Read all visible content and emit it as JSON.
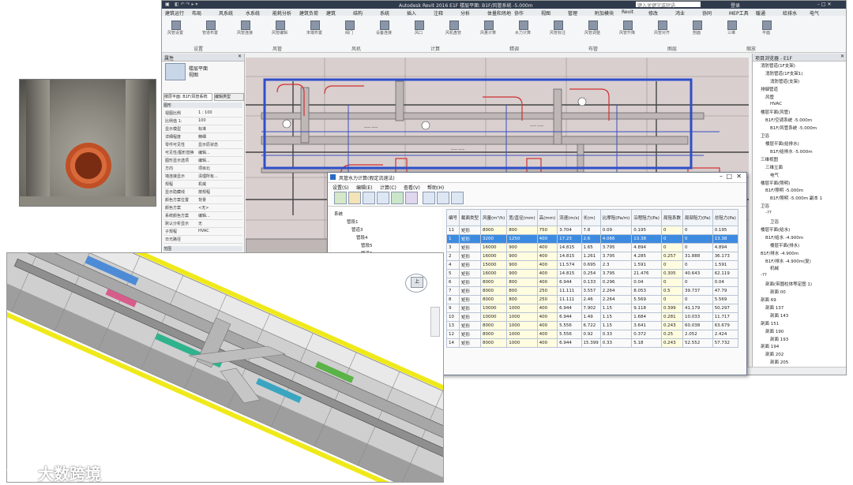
{
  "revit": {
    "title": "Autodesk Revit 2016    E1F    楼层平面: B1F/风管系统 -5.000m",
    "search_placeholder": "键入关键字或短语",
    "user": "登录",
    "menu": [
      "建筑",
      "结构",
      "系统",
      "插入",
      "注释",
      "分析",
      "体量和场地",
      "协作",
      "视图",
      "管理",
      "附加模块",
      "Revit",
      "修改",
      "鸿业",
      "协同",
      "MEP工具",
      "暖通",
      "给排水",
      "电气"
    ],
    "menu_prefix": [
      "建筑运行",
      "布局",
      "风系统",
      "水系统",
      "能耗分析",
      "建筑负荷"
    ],
    "ribbon_panels": [
      "设置",
      "风管",
      "风机",
      "计算",
      "精调",
      "布管",
      "图层",
      "缩放"
    ],
    "ribbon_buttons": [
      "风管设置",
      "管道布置",
      "风管连接",
      "风管编辑",
      "末端布置",
      "阀门",
      "设备连接",
      "风口",
      "风机盘管",
      "风量计算",
      "水力计算",
      "风管标注",
      "风管调整",
      "风管升降",
      "风管对齐",
      "剖面",
      "三维",
      "平面"
    ]
  },
  "properties": {
    "header": "属性",
    "type_label": "楼层平面",
    "type_value": "视图",
    "selector": "楼层平面: B1F/风管系统",
    "edit_type": "编辑类型",
    "section": "图形",
    "rows": [
      {
        "k": "视图比例",
        "v": "1 : 100"
      },
      {
        "k": "比例值 1:",
        "v": "100"
      },
      {
        "k": "显示模型",
        "v": "标准"
      },
      {
        "k": "详细程度",
        "v": "精细"
      },
      {
        "k": "零件可见性",
        "v": "显示原状态"
      },
      {
        "k": "可见性/图形替换",
        "v": "编辑..."
      },
      {
        "k": "图形显示选项",
        "v": "编辑..."
      },
      {
        "k": "方向",
        "v": "项目北"
      },
      {
        "k": "墙连接显示",
        "v": "清理所有..."
      },
      {
        "k": "规程",
        "v": "机械"
      },
      {
        "k": "显示隐藏线",
        "v": "按规程"
      },
      {
        "k": "颜色方案位置",
        "v": "背景"
      },
      {
        "k": "颜色方案",
        "v": "<无>"
      },
      {
        "k": "系统颜色方案",
        "v": "编辑..."
      },
      {
        "k": "默认分析显示",
        "v": "无"
      },
      {
        "k": "子规程",
        "v": "HVAC"
      },
      {
        "k": "日光路径",
        "v": ""
      }
    ],
    "footer": "范围"
  },
  "project_browser": {
    "title": "项目浏览器 - E1F",
    "items": [
      "消防管道(1F支架)",
      "消防管道(1F支架1)",
      "消防管道(支架)",
      "排烟管道",
      "风管",
      "HVAC",
      "楼层平面(风管)",
      "B1F/空调系统 -5.000m",
      "B1F/风管系统 -5.000m",
      "卫浴",
      "楼层平面(给排水)",
      "B1F/给排水 -5.000m",
      "三维视图",
      "三维立面",
      "电气",
      "楼层平面(照明)",
      "B1F/照明 -5.000m",
      "B1F/照明 -5.000m 副本 1",
      "卫浴",
      "-??",
      "卫浴",
      "楼层平面(给水)",
      "B1F/给水 -4.900m",
      "楼层平面(排水)",
      "B1F/排水 -4.900m",
      "B1F/排水 -4.900m(复)",
      "机械",
      "-??",
      "剖面(带圆柱体等定图 1)",
      "剖面 00",
      "剖面 69",
      "剖面 137",
      "剖面 143",
      "剖面 151",
      "剖面 190",
      "剖面 193",
      "剖面 194",
      "剖面 202",
      "剖面 205",
      "剖面 207"
    ]
  },
  "dialog": {
    "title": "风管水力计算(假定流速法)",
    "menu": [
      "设置(S)",
      "编辑(E)",
      "计算(C)",
      "查看(V)",
      "帮助(H)"
    ],
    "tree": [
      "系统",
      "管段1",
      "管道3",
      "管段4",
      "管段5",
      "管道6",
      "管段7"
    ],
    "columns": [
      "编号",
      "截面类型",
      "风量(m³/h)",
      "宽/直径(mm)",
      "高(mm)",
      "流速(m/s)",
      "长(m)",
      "比摩阻(Pa/m)",
      "沿程阻力(Pa)",
      "局阻系数",
      "局部阻力(Pa)",
      "总阻力(Pa)"
    ],
    "rows": [
      [
        "11",
        "矩形",
        "8000",
        "800",
        "750",
        "3.704",
        "7.8",
        "0.09",
        "0.195",
        "0",
        "0",
        "0.195"
      ],
      [
        "1",
        "矩形",
        "3200",
        "1250",
        "400",
        "17.23",
        "2.6",
        "4.066",
        "13.38",
        "0",
        "0",
        "13.38"
      ],
      [
        "3",
        "矩形",
        "16000",
        "900",
        "400",
        "14.815",
        "1.65",
        "3.795",
        "4.894",
        "0",
        "0",
        "4.894"
      ],
      [
        "2",
        "矩形",
        "16000",
        "900",
        "400",
        "14.815",
        "1.261",
        "3.795",
        "4.285",
        "0.257",
        "31.888",
        "36.173"
      ],
      [
        "4",
        "矩形",
        "15000",
        "900",
        "400",
        "11.574",
        "0.695",
        "2.3",
        "1.591",
        "0",
        "0",
        "1.591"
      ],
      [
        "5",
        "矩形",
        "16000",
        "900",
        "400",
        "14.815",
        "0.254",
        "3.795",
        "21.476",
        "0.305",
        "40.643",
        "62.119"
      ],
      [
        "6",
        "矩形",
        "8000",
        "800",
        "400",
        "6.944",
        "0.133",
        "0.296",
        "0.04",
        "0",
        "0",
        "0.04"
      ],
      [
        "7",
        "矩形",
        "8000",
        "800",
        "250",
        "11.111",
        "3.557",
        "2.264",
        "8.053",
        "0.5",
        "39.737",
        "47.79"
      ],
      [
        "8",
        "矩形",
        "8000",
        "800",
        "250",
        "11.111",
        "2.46",
        "2.264",
        "5.569",
        "0",
        "0",
        "5.569"
      ],
      [
        "9",
        "矩形",
        "10000",
        "1000",
        "400",
        "6.944",
        "7.902",
        "1.15",
        "9.118",
        "0.399",
        "41.179",
        "50.297"
      ],
      [
        "10",
        "矩形",
        "10000",
        "1000",
        "400",
        "6.944",
        "1.49",
        "1.15",
        "1.684",
        "0.281",
        "10.033",
        "11.717"
      ],
      [
        "13",
        "矩形",
        "8000",
        "1000",
        "400",
        "5.556",
        "6.722",
        "1.15",
        "3.641",
        "0.243",
        "60.038",
        "63.679"
      ],
      [
        "12",
        "矩形",
        "8000",
        "1000",
        "400",
        "5.556",
        "0.92",
        "0.33",
        "0.372",
        "0.25",
        "2.052",
        "2.424"
      ],
      [
        "14",
        "矩形",
        "8000",
        "1000",
        "400",
        "6.944",
        "15.399",
        "0.33",
        "5.18",
        "0.243",
        "52.552",
        "57.732"
      ]
    ]
  },
  "view3d": {
    "viewcube_label": "上"
  },
  "watermark": {
    "text": "大数跨境"
  }
}
